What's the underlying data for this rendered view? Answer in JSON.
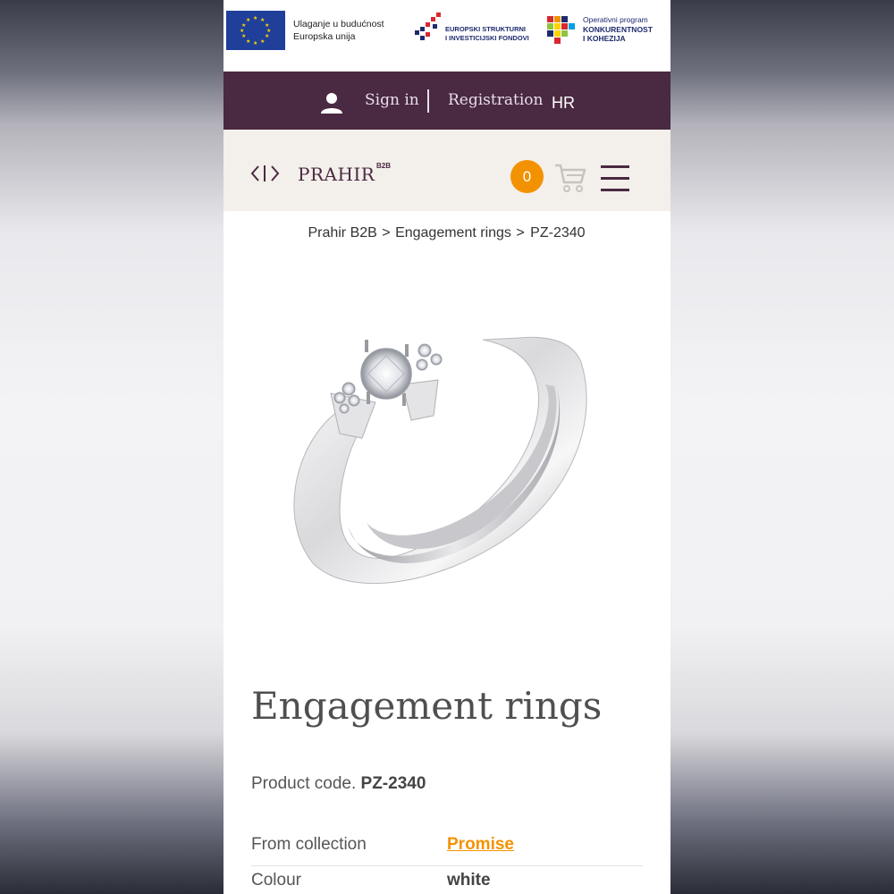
{
  "eu_banner": {
    "eu_text_line1": "Ulaganje u budućnost",
    "eu_text_line2": "Europska unija",
    "esif_line1": "EUROPSKI STRUKTURNI",
    "esif_line2": "I INVESTICIJSKI FONDOVI",
    "opk_line1": "Operativni program",
    "opk_line2": "KONKURENTNOST",
    "opk_line3": "I KOHEZIJA"
  },
  "top_nav": {
    "sign_in": "Sign in",
    "registration": "Registration",
    "language": "HR"
  },
  "header": {
    "logo_text": "PRAHIR",
    "logo_sup": "B2B",
    "cart_count": "0"
  },
  "breadcrumb": {
    "items": [
      "Prahir B2B",
      "Engagement rings",
      "PZ-2340"
    ],
    "separator": ">"
  },
  "product": {
    "title": "Engagement rings",
    "code_label": "Product code.",
    "code_value": "PZ-2340",
    "attributes": [
      {
        "label": "From collection",
        "value": "Promise"
      },
      {
        "label": "Colour",
        "value": "white"
      }
    ]
  },
  "colors": {
    "brand_purple": "#4a2942",
    "accent_orange": "#f39200",
    "header_bg": "#f3efea"
  }
}
